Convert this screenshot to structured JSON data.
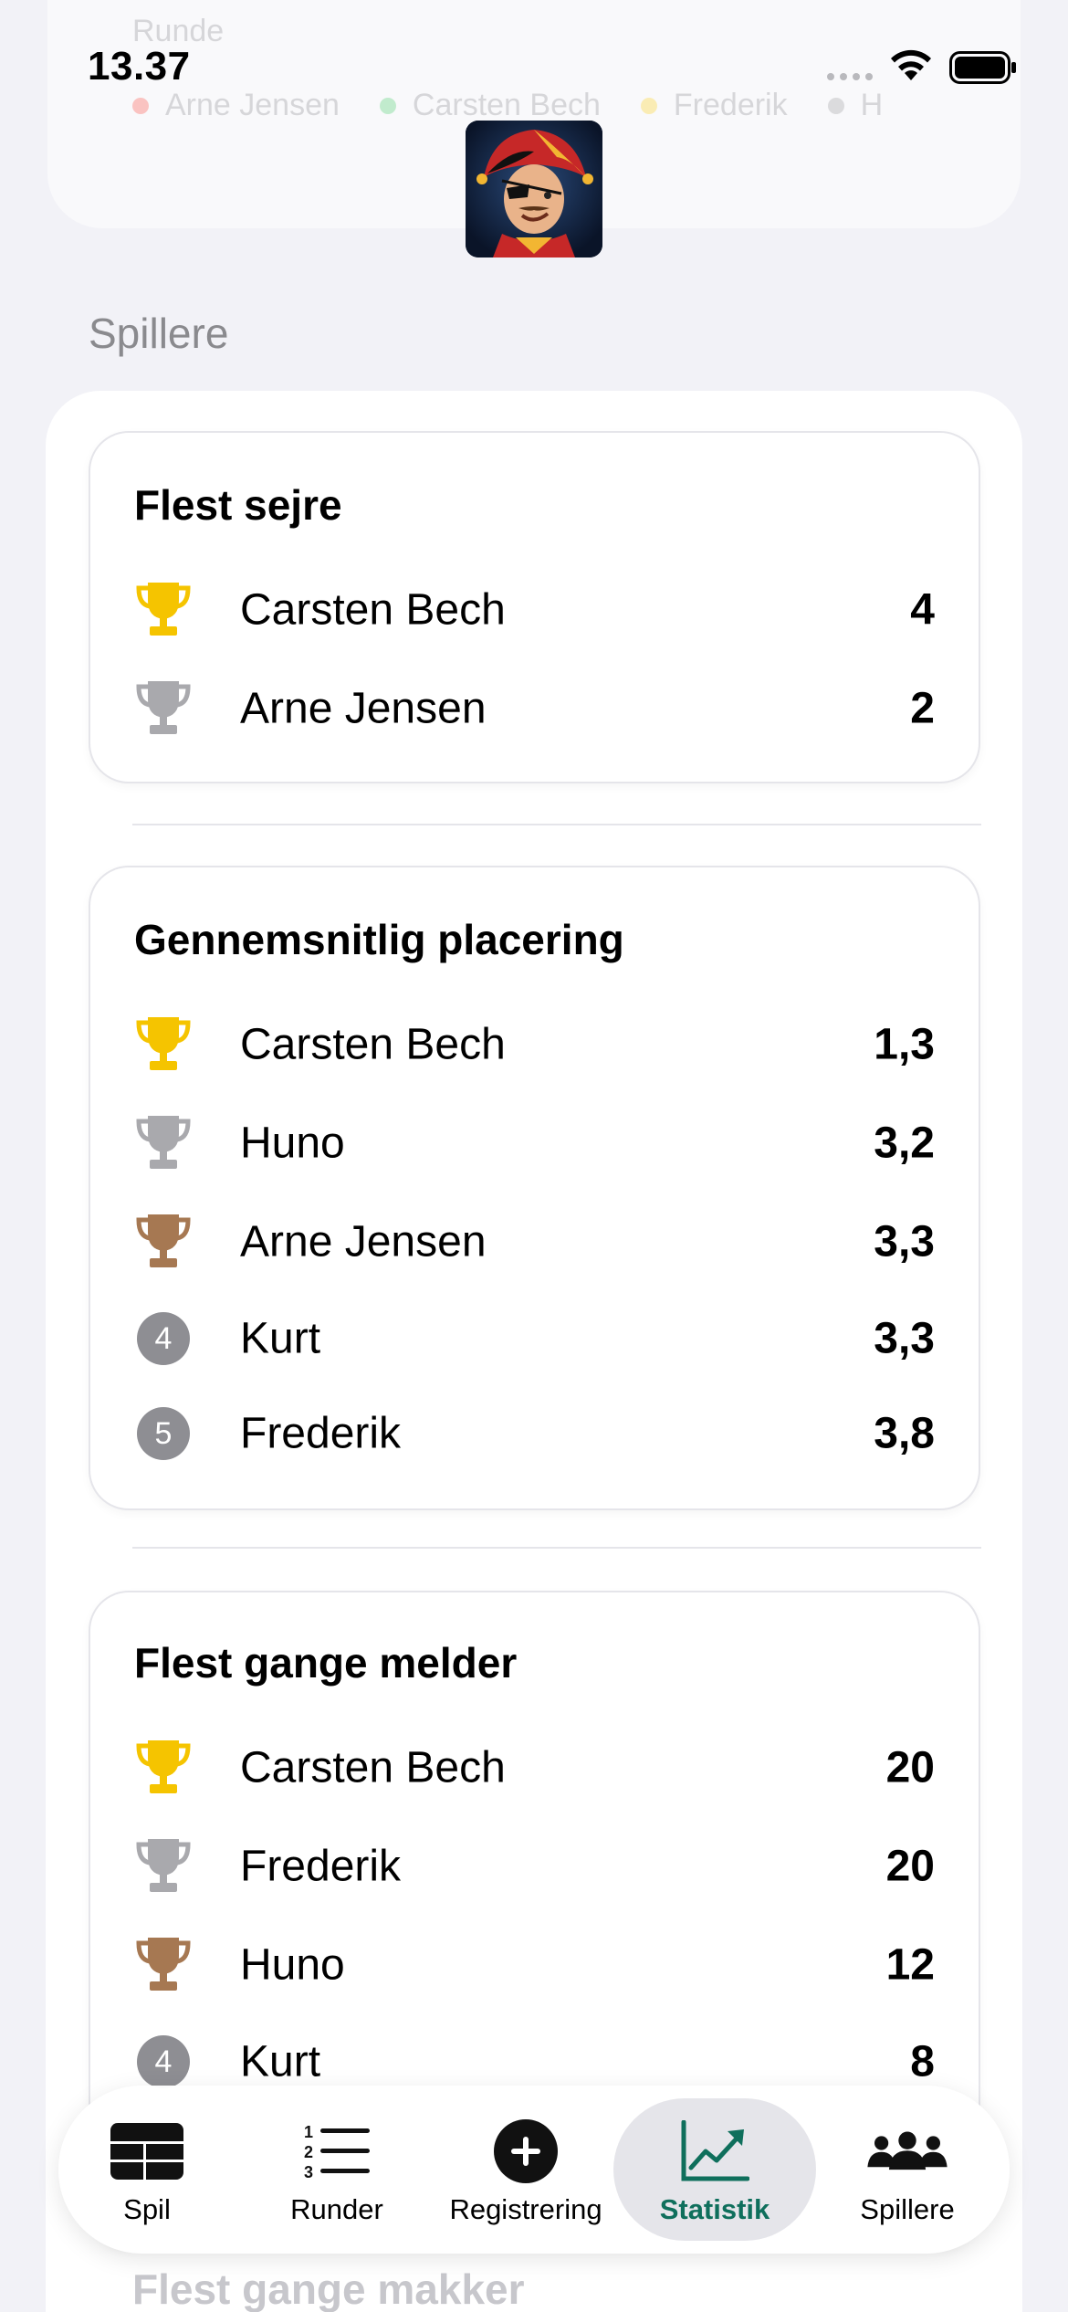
{
  "status_bar": {
    "time": "13.37"
  },
  "faded": {
    "title": "Runde",
    "legend": [
      {
        "name": "Arne Jensen",
        "color": "#ff3b30"
      },
      {
        "name": "Carsten Bech",
        "color": "#34c759"
      },
      {
        "name": "Frederik",
        "color": "#ffcc00"
      },
      {
        "name": "H",
        "color": "#8e8e93"
      }
    ]
  },
  "section_header": "Spillere",
  "cards": [
    {
      "title": "Flest sejre",
      "rows": [
        {
          "rank": "gold-trophy",
          "name": "Carsten Bech",
          "value": "4"
        },
        {
          "rank": "silver-trophy",
          "name": "Arne Jensen",
          "value": "2"
        }
      ]
    },
    {
      "title": "Gennemsnitlig placering",
      "rows": [
        {
          "rank": "gold-trophy",
          "name": "Carsten Bech",
          "value": "1,3"
        },
        {
          "rank": "silver-trophy",
          "name": "Huno",
          "value": "3,2"
        },
        {
          "rank": "bronze-trophy",
          "name": "Arne Jensen",
          "value": "3,3"
        },
        {
          "rank": "4",
          "name": "Kurt",
          "value": "3,3"
        },
        {
          "rank": "5",
          "name": "Frederik",
          "value": "3,8"
        }
      ]
    },
    {
      "title": "Flest gange melder",
      "rows": [
        {
          "rank": "gold-trophy",
          "name": "Carsten Bech",
          "value": "20"
        },
        {
          "rank": "silver-trophy",
          "name": "Frederik",
          "value": "20"
        },
        {
          "rank": "bronze-trophy",
          "name": "Huno",
          "value": "12"
        },
        {
          "rank": "4",
          "name": "Kurt",
          "value": "8"
        }
      ]
    }
  ],
  "next_section": "Flest gange makker",
  "tabs": [
    {
      "label": "Spil",
      "icon": "table-grid-icon",
      "active": false
    },
    {
      "label": "Runder",
      "icon": "numbered-list-icon",
      "active": false
    },
    {
      "label": "Registrering",
      "icon": "plus-circle-icon",
      "active": false
    },
    {
      "label": "Statistik",
      "icon": "chart-line-icon",
      "active": true
    },
    {
      "label": "Spillere",
      "icon": "people-icon",
      "active": false
    }
  ],
  "colors": {
    "accent": "#0f6f5c",
    "gold": "#f5c400",
    "silver": "#a9a9ad",
    "bronze": "#a67852"
  }
}
